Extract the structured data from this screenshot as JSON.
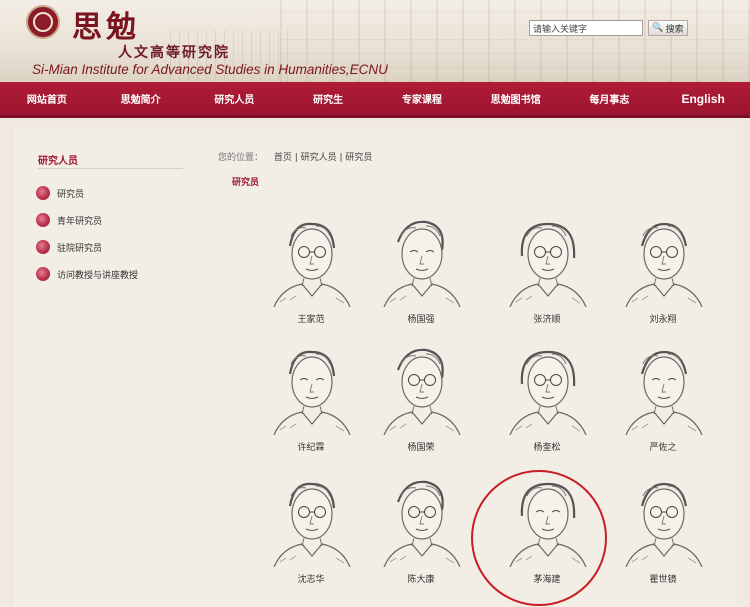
{
  "header": {
    "title_cn": "思勉",
    "subtitle_cn": "人文高等研究院",
    "subtitle_en": "Si-Mian Institute for Advanced Studies in Humanities,ECNU",
    "search_placeholder": "请输入关键字",
    "search_button": "搜索"
  },
  "nav": {
    "items": [
      {
        "label": "网站首页"
      },
      {
        "label": "思勉简介"
      },
      {
        "label": "研究人员"
      },
      {
        "label": "研究生"
      },
      {
        "label": "专家课程"
      },
      {
        "label": "思勉图书馆"
      },
      {
        "label": "每月事志"
      },
      {
        "label": "English"
      }
    ]
  },
  "sidebar": {
    "title": "研究人员",
    "items": [
      {
        "label": "研究员"
      },
      {
        "label": "青年研究员"
      },
      {
        "label": "驻院研究员"
      },
      {
        "label": "访问教授与讲座教授"
      }
    ]
  },
  "breadcrumb": {
    "location_label": "您的位置：",
    "path": "首页 | 研究人员 | 研究员"
  },
  "section_title": "研究员",
  "people": [
    {
      "name": "王家范"
    },
    {
      "name": "杨国强"
    },
    {
      "name": "张济顺"
    },
    {
      "name": "刘永翔"
    },
    {
      "name": "许纪霖"
    },
    {
      "name": "杨国荣"
    },
    {
      "name": "杨奎松"
    },
    {
      "name": "严佐之"
    },
    {
      "name": "沈志华"
    },
    {
      "name": "陈大康"
    },
    {
      "name": "茅海建"
    },
    {
      "name": "瞿世镜"
    }
  ],
  "colors": {
    "nav_bg": "#a8193a",
    "accent": "#a01830",
    "highlight_circle": "#c81e26"
  }
}
